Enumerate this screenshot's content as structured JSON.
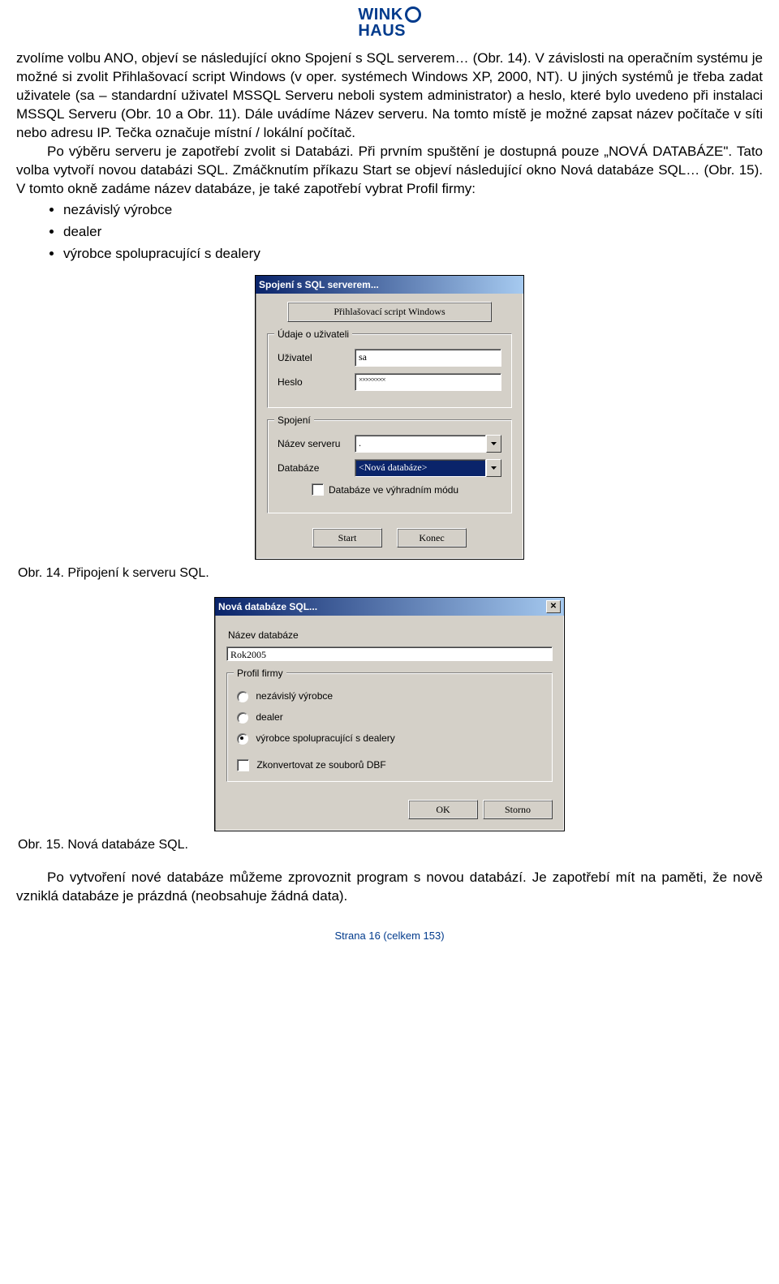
{
  "logo": {
    "line1a": "WINK",
    "line2": "HAUS"
  },
  "para1": "zvolíme volbu ANO, objeví se následující okno Spojení s SQL serverem… (Obr. 14). V závislosti na operačním systému je možné si zvolit Přihlašovací script Windows (v oper. systémech Windows XP, 2000, NT). U jiných systémů je třeba zadat uživatele (sa – standardní uživatel MSSQL Serveru neboli system administrator) a heslo, které bylo uvedeno při instalaci MSSQL Serveru (Obr. 10 a Obr. 11). Dále uvádíme Název serveru. Na tomto místě je možné zapsat název počítače v síti nebo adresu IP. Tečka označuje místní / lokální počítač.",
  "para2": "Po výběru serveru je zapotřebí zvolit si Databázi. Při prvním spuštění je dostupná pouze „NOVÁ DATABÁZE\". Tato volba vytvoří novou databázi SQL. Zmáčknutím příkazu Start se objeví následující okno Nová databáze SQL… (Obr. 15). V tomto okně zadáme název databáze, je také zapotřebí vybrat Profil firmy:",
  "bullets": [
    "nezávislý výrobce",
    "dealer",
    "výrobce spolupracující s dealery"
  ],
  "dlg1": {
    "title": "Spojení s SQL serverem...",
    "login_btn": "Přihlašovací script Windows",
    "user_legend": "Údaje o uživateli",
    "user_label": "Uživatel",
    "user_value": "sa",
    "pass_label": "Heslo",
    "pass_value": "××××××××",
    "conn_legend": "Spojení",
    "server_label": "Název serveru",
    "server_value": ".",
    "db_label": "Databáze",
    "db_value": "<Nová databáze>",
    "exclusive": "Databáze ve výhradním módu",
    "start": "Start",
    "end": "Konec"
  },
  "cap1": "Obr. 14. Připojení k serveru SQL.",
  "dlg2": {
    "title": "Nová databáze SQL...",
    "name_label": "Název databáze",
    "name_value": "Rok2005",
    "profile_legend": "Profil firmy",
    "r1": "nezávislý výrobce",
    "r2": "dealer",
    "r3": "výrobce spolupracující s dealery",
    "convert": "Zkonvertovat ze souborů DBF",
    "ok": "OK",
    "cancel": "Storno"
  },
  "cap2": "Obr. 15. Nová databáze SQL.",
  "para3": "Po vytvoření nové databáze můžeme zprovoznit program s novou databází. Je zapotřebí mít na paměti, že nově vzniklá databáze je prázdná (neobsahuje žádná data).",
  "footer": "Strana 16 (celkem 153)"
}
